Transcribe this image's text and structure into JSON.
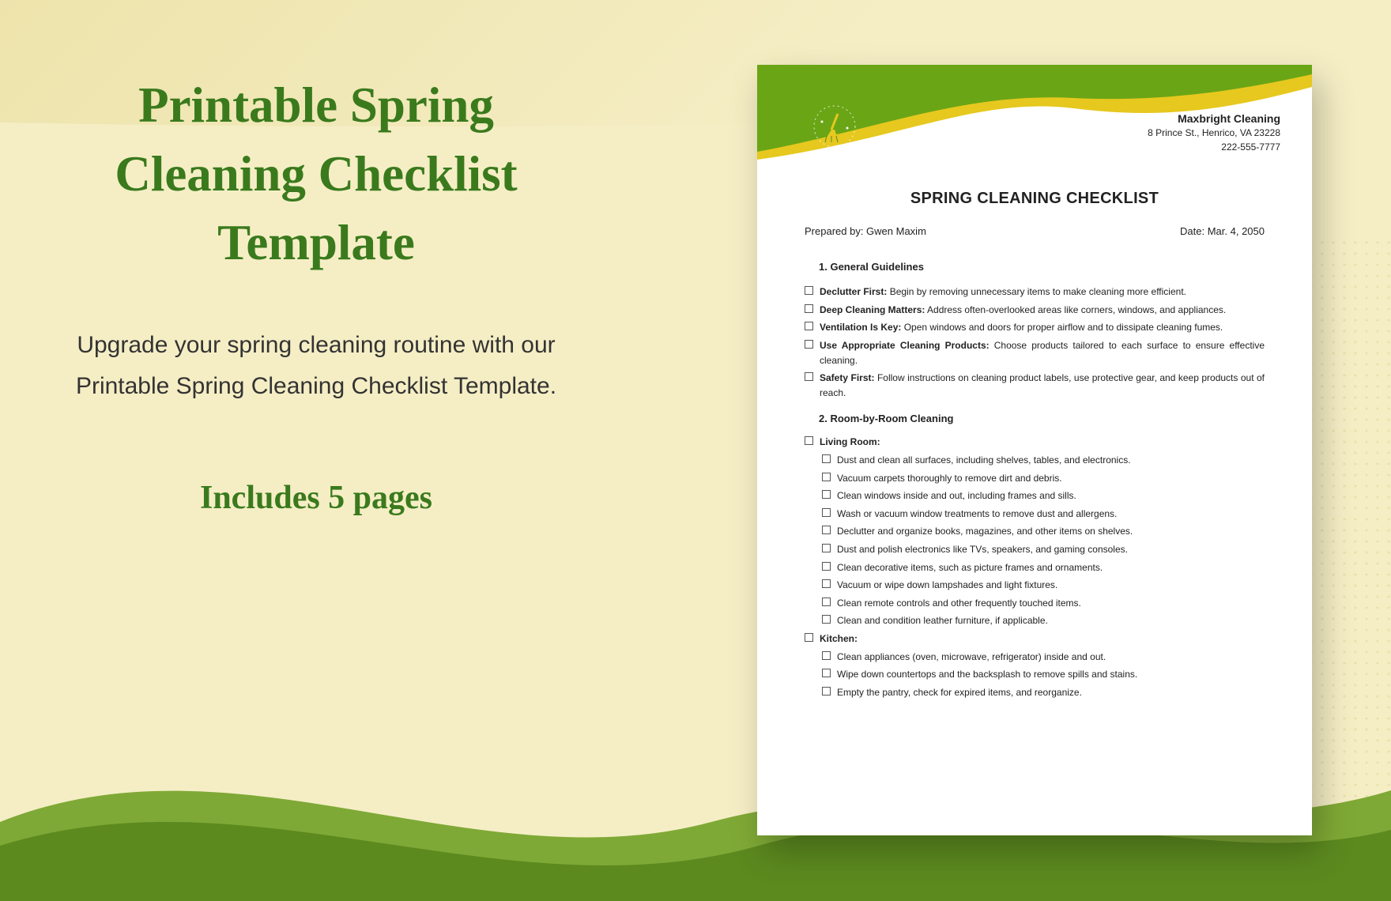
{
  "promo": {
    "title": "Printable Spring Cleaning Checklist Template",
    "description": "Upgrade your spring cleaning routine with our Printable Spring Cleaning Checklist Template.",
    "pages_line": "Includes 5 pages"
  },
  "doc": {
    "company": {
      "name": "Maxbright Cleaning",
      "address": "8 Prince St., Henrico, VA 23228",
      "phone": "222-555-7777"
    },
    "title": "SPRING CLEANING CHECKLIST",
    "prepared_by_label": "Prepared by: ",
    "prepared_by": "Gwen Maxim",
    "date_label": "Date: ",
    "date": "Mar. 4, 2050",
    "section1_heading": "1.  General Guidelines",
    "guidelines": [
      {
        "bold": "Declutter First:",
        "text": " Begin by removing unnecessary items to make cleaning more efficient."
      },
      {
        "bold": "Deep Cleaning Matters:",
        "text": " Address often-overlooked areas like corners, windows, and appliances."
      },
      {
        "bold": "Ventilation Is Key:",
        "text": " Open windows and doors for proper airflow and to dissipate cleaning fumes."
      },
      {
        "bold": "Use Appropriate Cleaning Products:",
        "text": " Choose products tailored to each surface to ensure effective cleaning."
      },
      {
        "bold": "Safety First:",
        "text": " Follow instructions on cleaning product labels, use protective gear, and keep products out of reach."
      }
    ],
    "section2_heading": "2.  Room-by-Room Cleaning",
    "living_room_label": "Living Room:",
    "living_room": [
      "Dust and clean all surfaces, including shelves, tables, and electronics.",
      "Vacuum carpets thoroughly to remove dirt and debris.",
      "Clean windows inside and out, including frames and sills.",
      "Wash or vacuum window treatments to remove dust and allergens.",
      "Declutter and organize books, magazines, and other items on shelves.",
      "Dust and polish electronics like TVs, speakers, and gaming consoles.",
      "Clean decorative items, such as picture frames and ornaments.",
      "Vacuum or wipe down lampshades and light fixtures.",
      "Clean remote controls and other frequently touched items.",
      "Clean and condition leather furniture, if applicable."
    ],
    "kitchen_label": "Kitchen:",
    "kitchen": [
      "Clean appliances (oven, microwave, refrigerator) inside and out.",
      "Wipe down countertops and the backsplash to remove spills and stains.",
      "Empty the pantry, check for expired items, and reorganize."
    ]
  },
  "colors": {
    "brand_green": "#3a7a1d",
    "header_green": "#6aa516",
    "accent_yellow": "#e6c81e",
    "background": "#f5eec5"
  }
}
